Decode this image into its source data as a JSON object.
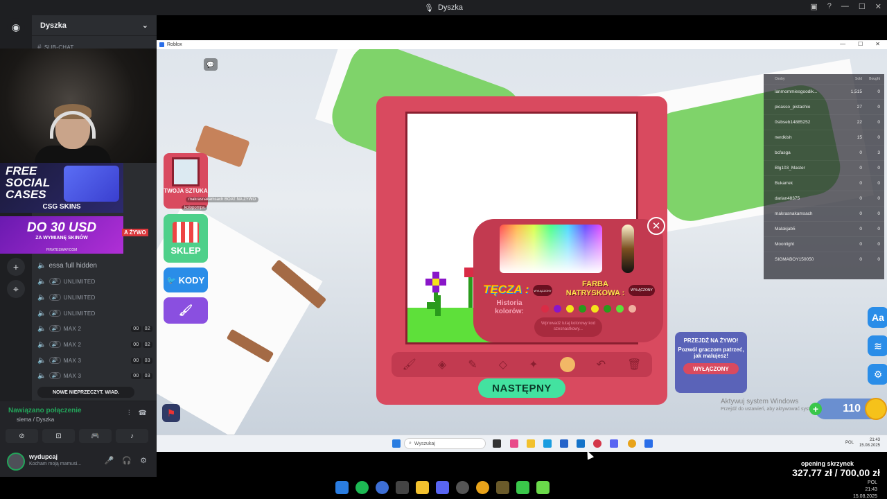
{
  "window": {
    "title": "Dyszka"
  },
  "server": {
    "name": "Dyszka"
  },
  "channels": [
    {
      "name": "SUB-CHAT"
    },
    {
      "name": "essa full hidden"
    },
    {
      "name": "UNLIMITED"
    },
    {
      "name": "UNLIMITED"
    },
    {
      "name": "UNLIMITED"
    },
    {
      "name": "MAX 2",
      "a": "00",
      "b": "02"
    },
    {
      "name": "MAX 2",
      "a": "00",
      "b": "02"
    },
    {
      "name": "MAX 3",
      "a": "00",
      "b": "03"
    },
    {
      "name": "MAX 3",
      "a": "00",
      "b": "03"
    }
  ],
  "unread_label": "NOWE NIEPRZECZYT. WIAD.",
  "voice": {
    "status": "Nawiązano połączenie",
    "location": "siema / Dyszka"
  },
  "user": {
    "name": "wydupcaj",
    "status": "Kocham moją mamusi..."
  },
  "ads": {
    "free_line": "FREE\nSOCIAL\nCASES",
    "brand": "CSG SKINS",
    "promo": "DO 30 USD",
    "promo_sub": "ZA WYMIANĘ SKINÓW",
    "promo_site": "PIRATESWAP.COM",
    "live": "A ŻYWO"
  },
  "roblox": {
    "title": "Roblox",
    "art_label": "TWOJA SZTUKA",
    "shop_label": "SKLEP",
    "codes_label": "KODY",
    "player1": "makrasnakamsach   BOAT   NA ŻYWO",
    "player2": "kolopompa",
    "next_button": "NASTĘPNY",
    "rainbow": "TĘCZA :",
    "rainbow_toggle": "WYŁĄCZONY",
    "spray": "FARBA NATRYSKOWA :",
    "spray_toggle": "WYŁĄCZONY",
    "history": "Historia kolorów:",
    "hex_placeholder": "Wprowadź tutaj kolorowy kod szesnastkowy...",
    "history_colors": [
      "#d92c46",
      "#8a16c9",
      "#f4e41a",
      "#2a9a1c",
      "#f4e41a",
      "#2a9a1c",
      "#5ee03a",
      "#f0b0a0"
    ],
    "live_panel": {
      "title": "PRZEJDŹ NA ŻYWO!",
      "desc": "Pozwól graczom patrzeć, jak malujesz!",
      "button": "WYŁĄCZONY"
    },
    "coins": "110",
    "activate": "Aktywuj system Windows",
    "activate_sub": "Przejdź do ustawień, aby aktywować system Windows.",
    "leaderboard": {
      "headers": [
        "Osoby",
        "Sold",
        "Bought"
      ],
      "rows": [
        [
          "lanmommiesgoodik...",
          "1,515",
          "0"
        ],
        [
          "picasso_pistachio",
          "27",
          "0"
        ],
        [
          "0sibseb14885252",
          "22",
          "0"
        ],
        [
          "nerdkish",
          "15",
          "0"
        ],
        [
          "bcfasga",
          "0",
          "3"
        ],
        [
          "Blg103_Master",
          "0",
          "0"
        ],
        [
          "Bukarrek",
          "0",
          "0"
        ],
        [
          "darian48375",
          "0",
          "0"
        ],
        [
          "makrasnakamsach",
          "0",
          "0"
        ],
        [
          "Malakjab5",
          "0",
          "0"
        ],
        [
          "Moonlight",
          "0",
          "0"
        ],
        [
          "SIGMABOY150050",
          "0",
          "0"
        ]
      ]
    },
    "taskbar_search": "Wyszukaj",
    "tray_time": "21:43",
    "tray_date": "15.08.2025",
    "tray_lang": "POL"
  },
  "overlay": {
    "label": "opening skrzynek",
    "amount": "327,77 zł / 700,00 zł"
  },
  "outer_tray": {
    "lang": "POL",
    "time": "21:43",
    "date": "15.08.2025"
  },
  "colors": {
    "discord_bg": "#2b2d31",
    "easel": "#d94a5f",
    "next": "#43e2a0",
    "accent_green": "#23a55a"
  }
}
